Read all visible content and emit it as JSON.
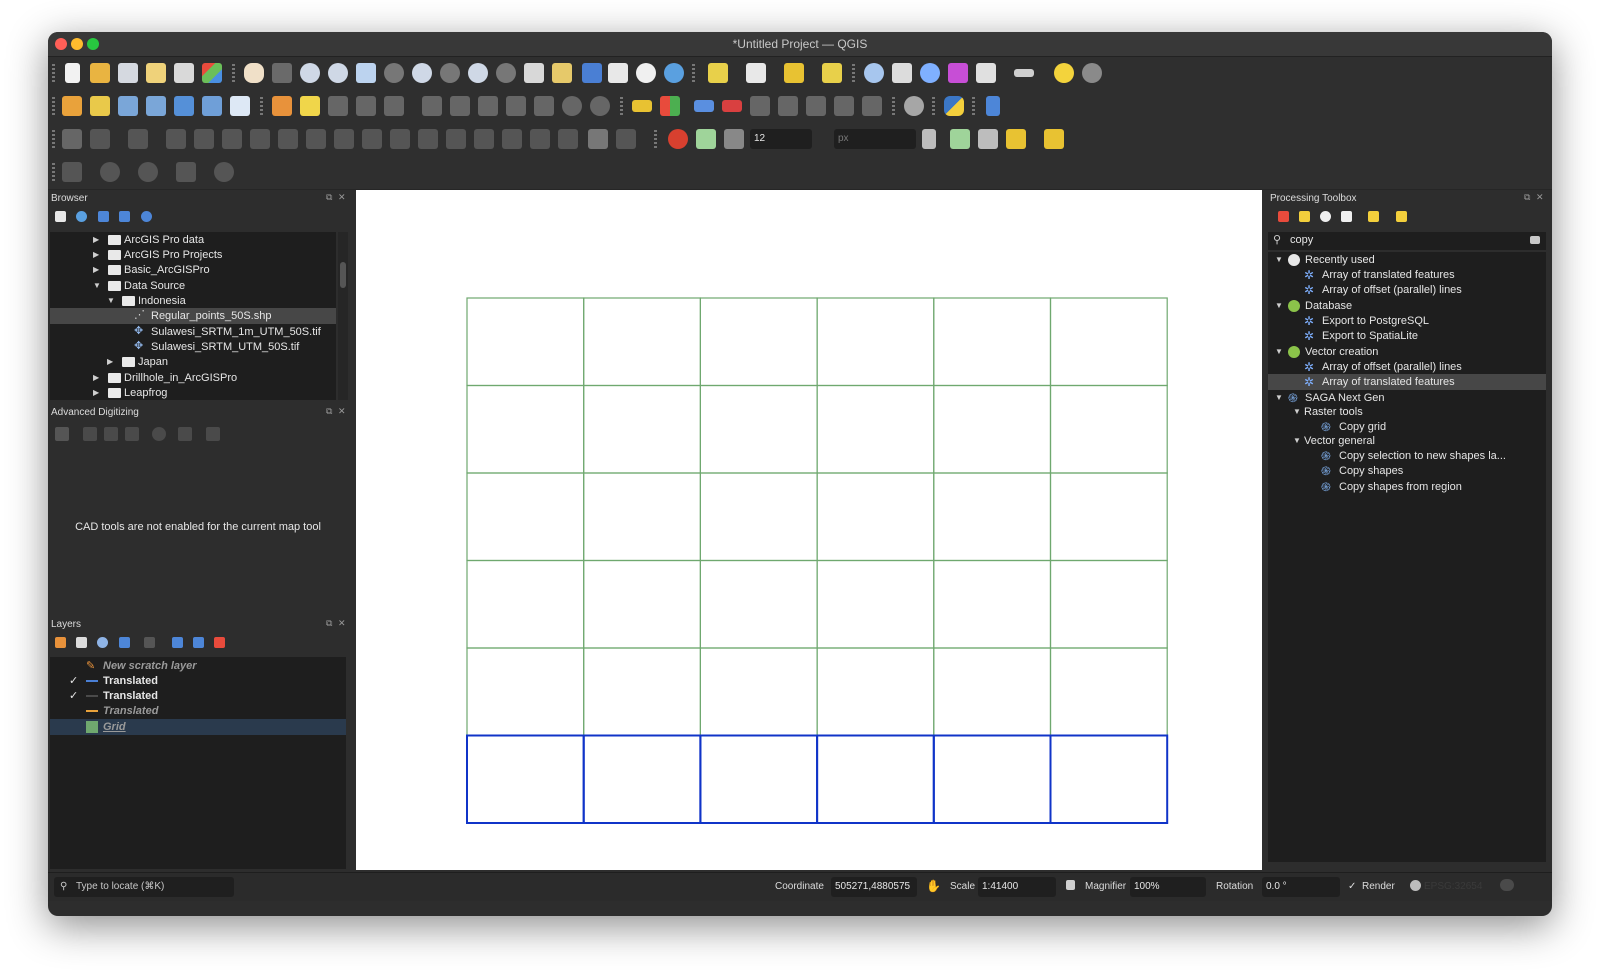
{
  "window": {
    "title": "*Untitled Project — QGIS"
  },
  "toolbars": {
    "snapping_tolerance": "12",
    "snapping_unit": "px"
  },
  "browser": {
    "title": "Browser",
    "items": [
      {
        "label": "ArcGIS Pro data"
      },
      {
        "label": "ArcGIS Pro Projects"
      },
      {
        "label": "Basic_ArcGISPro"
      },
      {
        "label": "Data Source"
      },
      {
        "label": "Indonesia"
      },
      {
        "label": "Regular_points_50S.shp"
      },
      {
        "label": "Sulawesi_SRTM_1m_UTM_50S.tif"
      },
      {
        "label": "Sulawesi_SRTM_UTM_50S.tif"
      },
      {
        "label": "Japan"
      },
      {
        "label": "Drillhole_in_ArcGISPro"
      },
      {
        "label": "Leapfrog"
      }
    ]
  },
  "advanced_digitizing": {
    "title": "Advanced Digitizing",
    "message": "CAD tools are not enabled for the current map tool"
  },
  "layers": {
    "title": "Layers",
    "items": [
      {
        "label": "New scratch layer",
        "checked": false
      },
      {
        "label": "Translated",
        "checked": true
      },
      {
        "label": "Translated",
        "checked": true
      },
      {
        "label": "Translated",
        "checked": false
      },
      {
        "label": "Grid",
        "checked": false
      }
    ],
    "check_mark": "✓"
  },
  "map": {
    "grid_color": "#6fa86f",
    "highlight_color": "#1034c8",
    "columns": 6,
    "rows": 6,
    "highlighted_row": 6
  },
  "toolbox": {
    "title": "Processing Toolbox",
    "search_value": "copy",
    "groups": [
      {
        "label": "Recently used",
        "items": [
          {
            "label": "Array of translated features"
          },
          {
            "label": "Array of offset (parallel) lines"
          }
        ]
      },
      {
        "label": "Database",
        "items": [
          {
            "label": "Export to PostgreSQL"
          },
          {
            "label": "Export to SpatiaLite"
          }
        ]
      },
      {
        "label": "Vector creation",
        "items": [
          {
            "label": "Array of offset (parallel) lines"
          },
          {
            "label": "Array of translated features"
          }
        ]
      },
      {
        "label": "SAGA Next Gen",
        "subgroups": [
          {
            "label": "Raster tools",
            "items": [
              {
                "label": "Copy grid"
              }
            ]
          },
          {
            "label": "Vector general",
            "items": [
              {
                "label": "Copy selection to new shapes la..."
              },
              {
                "label": "Copy shapes"
              },
              {
                "label": "Copy shapes from region"
              }
            ]
          }
        ]
      }
    ]
  },
  "statusbar": {
    "locate_placeholder": "Type to locate (⌘K)",
    "coordinate_label": "Coordinate",
    "coordinate_value": "505271,4880575",
    "scale_label": "Scale",
    "scale_value": "1:41400",
    "magnifier_label": "Magnifier",
    "magnifier_value": "100%",
    "rotation_label": "Rotation",
    "rotation_value": "0.0 °",
    "render_label": "Render",
    "render_check": "✓",
    "crs_value": "EPSG:32654"
  }
}
